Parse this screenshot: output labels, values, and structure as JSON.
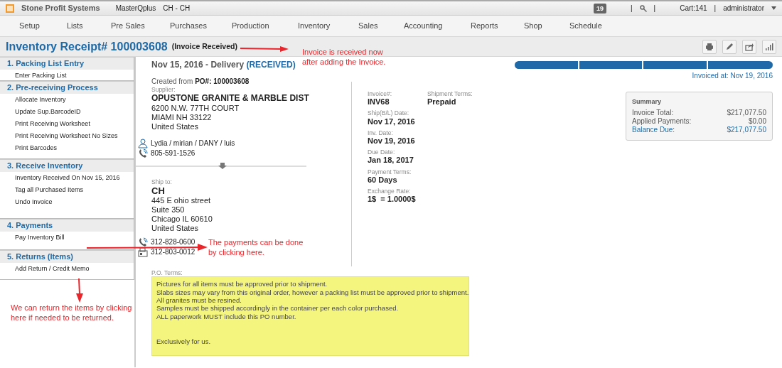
{
  "topbar": {
    "brand": "Stone Profit Systems",
    "company": "MasterQplus",
    "location": "CH - CH",
    "notifications": "19",
    "separators": [
      "|",
      "|",
      "|"
    ],
    "cart": "Cart:141",
    "user": "administrator"
  },
  "menu": [
    "Setup",
    "Lists",
    "Pre Sales",
    "Purchases",
    "Production",
    "Inventory",
    "Sales",
    "Accounting",
    "Reports",
    "Shop",
    "Schedule"
  ],
  "header": {
    "title": "Inventory Receipt# 100003608",
    "status": "(Invoice Received)"
  },
  "sidebar": [
    {
      "heading": "1. Packing List Entry",
      "items": [
        "Enter Packing List"
      ]
    },
    {
      "heading": "2. Pre-receiving Process",
      "items": [
        "Allocate Inventory",
        "Update Sup.BarcodeID",
        "Print Receiving Worksheet",
        "Print Receiving Worksheet No Sizes",
        "Print Barcodes"
      ]
    },
    {
      "heading": "3. Receive Inventory",
      "items": [
        "Inventory Received On Nov 15, 2016",
        "Tag all Purchased Items",
        "Undo Invoice"
      ]
    },
    {
      "heading": "4. Payments",
      "items": [
        "Pay Inventory Bill"
      ]
    },
    {
      "heading": "5. Returns (Items)",
      "items": [
        "Add Return / Credit Memo"
      ]
    }
  ],
  "receipt": {
    "date_line": "Nov 15, 2016 - Delivery",
    "state": "(RECEIVED)",
    "created_label": "Created from",
    "po_label": "PO#:",
    "po_number": "100003608",
    "steps": [
      {
        "done": true
      },
      {
        "done": true
      },
      {
        "done": true
      },
      {
        "done": true
      }
    ],
    "invoiced_at": "Invoiced at: Nov 19, 2016",
    "supplier": {
      "label": "Supplier:",
      "name": "OPUSTONE GRANITE & MARBLE DIST",
      "address": [
        "6200 N.W. 77TH COURT",
        "MIAMI NH 33122",
        "United States"
      ],
      "contacts": "Lydia / mirian / DANY / luis",
      "phone": "805-591-1526"
    },
    "ship_to": {
      "label": "Ship to:",
      "name": "CH",
      "address": [
        "445 E ohio street",
        "Suite 350",
        "Chicago IL 60610",
        "United States"
      ],
      "phone": "312-828-0600",
      "fax": "312-803-0012"
    },
    "details": [
      {
        "label": "Invoice#:",
        "value": "INV68"
      },
      {
        "label": "Ship(B/L) Date:",
        "value": "Nov 17, 2016"
      },
      {
        "label": "Inv. Date:",
        "value": "Nov 19, 2016"
      },
      {
        "label": "Due Date:",
        "value": "Jan 18, 2017"
      },
      {
        "label": "Payment Terms:",
        "value": "60 Days"
      },
      {
        "label": "Exchange Rate:",
        "value": "1$  = 1.0000$"
      }
    ],
    "shipment_terms": {
      "label": "Shipment Terms:",
      "value": "Prepaid"
    },
    "summary": {
      "title": "Summary",
      "rows": [
        {
          "label": "Invoice Total:",
          "value": "$217,077.50",
          "highlight": false
        },
        {
          "label": "Applied Payments:",
          "value": "$0.00",
          "highlight": false
        },
        {
          "label": "Balance Due:",
          "value": "$217,077.50",
          "highlight": true
        }
      ]
    },
    "po_terms": {
      "label": "P.O. Terms:",
      "lines": [
        "Pictures for all items must be approved prior to shipment.",
        "Slabs sizes may vary from this original order, however a packing list must be approved prior to shipment.",
        "All granites must be resined.",
        "Samples must be shipped accordingly in the container per each color purchased.",
        "ALL paperwork MUST include this PO number."
      ],
      "closing": "Exclusively for us."
    }
  },
  "annotations": [
    {
      "lines": [
        "Invoice is received now",
        "after adding the Invoice."
      ]
    },
    {
      "lines": [
        "The payments can be done",
        "by clicking here."
      ]
    },
    {
      "lines": [
        "We can return the items by clicking",
        "here if needed to be returned."
      ]
    }
  ]
}
